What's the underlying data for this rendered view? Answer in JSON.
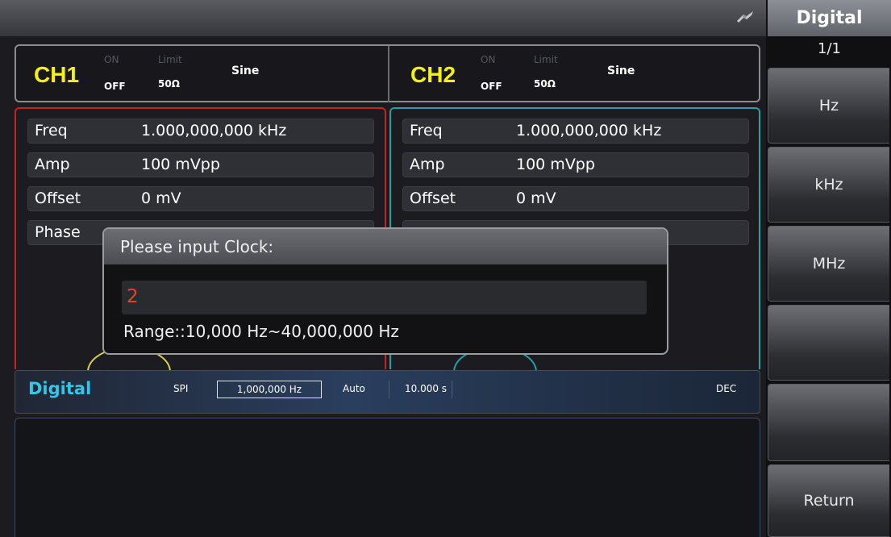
{
  "menu": {
    "title": "Digital",
    "page": "1/1",
    "softkeys": [
      {
        "label": "Hz"
      },
      {
        "label": "kHz"
      },
      {
        "label": "MHz"
      },
      {
        "label": ""
      },
      {
        "label": ""
      },
      {
        "label": "Return"
      }
    ]
  },
  "status": {
    "usb_icon": "usb-icon"
  },
  "channels": [
    {
      "name": "CH1",
      "output_on": "ON",
      "output_off": "OFF",
      "limit": "Limit",
      "load": "50Ω",
      "wave": "Sine",
      "color": "#c22326"
    },
    {
      "name": "CH2",
      "output_on": "ON",
      "output_off": "OFF",
      "limit": "Limit",
      "load": "50Ω",
      "wave": "Sine",
      "color": "#1fa3a8"
    }
  ],
  "ch1_params": [
    {
      "label": "Freq",
      "value": "1.000,000,000 kHz"
    },
    {
      "label": "Amp",
      "value": "100 mVpp"
    },
    {
      "label": "Offset",
      "value": "0 mV"
    },
    {
      "label": "Phase",
      "value": ""
    }
  ],
  "ch2_params": [
    {
      "label": "Freq",
      "value": "1.000,000,000 kHz"
    },
    {
      "label": "Amp",
      "value": "100 mVpp"
    },
    {
      "label": "Offset",
      "value": "0 mV"
    },
    {
      "label": "",
      "value": ""
    }
  ],
  "digital": {
    "title": "Digital",
    "protocol": "SPI",
    "clock": "1,000,000 Hz",
    "mode": "Auto",
    "time": "10.000 s",
    "format": "DEC"
  },
  "dialog": {
    "title": "Please input Clock:",
    "value": "2",
    "range": "Range::10,000 Hz~40,000,000 Hz"
  }
}
